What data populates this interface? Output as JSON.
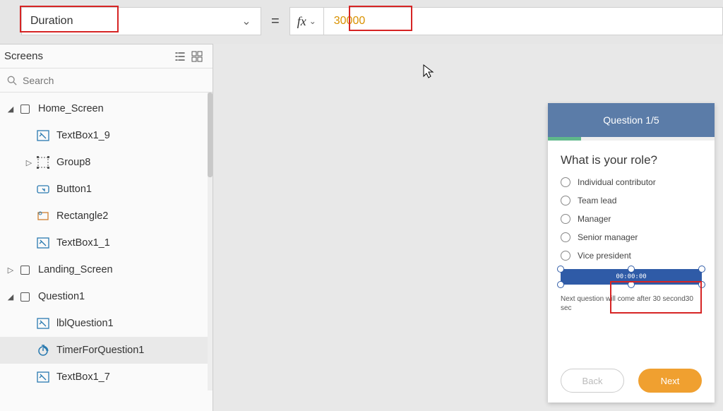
{
  "formula": {
    "property": "Duration",
    "value": "30000"
  },
  "panel": {
    "title": "Screens",
    "searchPlaceholder": "Search"
  },
  "tree": {
    "home": "Home_Screen",
    "textbox19": "TextBox1_9",
    "group8": "Group8",
    "button1": "Button1",
    "rectangle2": "Rectangle2",
    "textbox11": "TextBox1_1",
    "landing": "Landing_Screen",
    "question1": "Question1",
    "lblQuestion1": "lblQuestion1",
    "timer": "TimerForQuestion1",
    "textbox17": "TextBox1_7"
  },
  "preview": {
    "header": "Question 1/5",
    "question": "What is your role?",
    "options": [
      "Individual contributor",
      "Team lead",
      "Manager",
      "Senior manager",
      "Vice president"
    ],
    "timerText": "00:00:00",
    "helper": "Next question will come after 30 second30 sec",
    "back": "Back",
    "next": "Next"
  }
}
